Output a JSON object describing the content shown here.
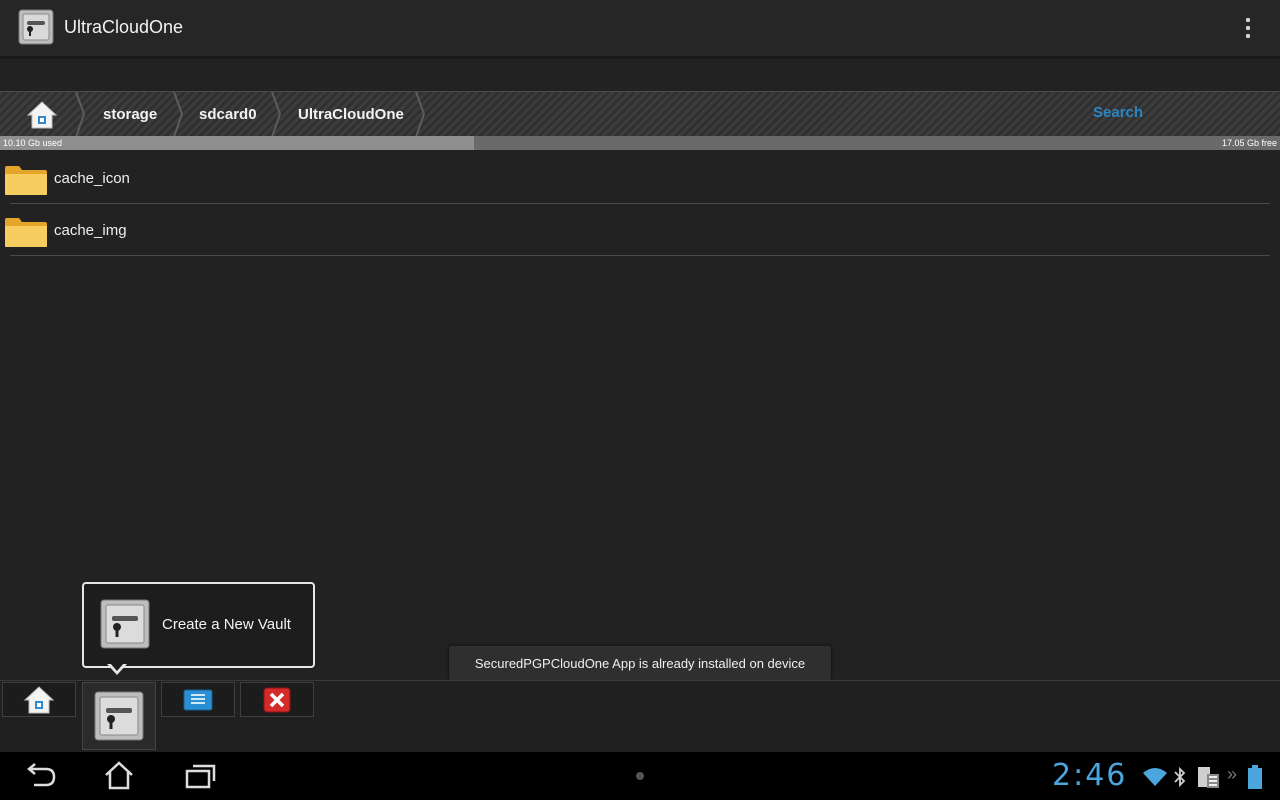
{
  "app": {
    "title": "UltraCloudOne",
    "icon": "vault-key-icon"
  },
  "breadcrumb": {
    "home_icon": "home-icon",
    "items": [
      "storage",
      "sdcard0",
      "UltraCloudOne"
    ],
    "search_label": "Search"
  },
  "storage": {
    "used_label": "10.10 Gb used",
    "free_label": "17.05 Gb free",
    "used_fraction": 0.37
  },
  "files": [
    {
      "name": "cache_icon",
      "icon": "folder-icon"
    },
    {
      "name": "cache_img",
      "icon": "folder-icon"
    }
  ],
  "popup": {
    "label": "Create a New Vault",
    "icon": "vault-key-icon"
  },
  "toast": {
    "message": "SecuredPGPCloudOne App is already installed on device"
  },
  "toolbar": {
    "buttons": [
      "home-icon",
      "vault-key-icon",
      "file-icon",
      "close-icon"
    ]
  },
  "status": {
    "time": "2:46"
  },
  "colors": {
    "accent": "#2b86c4",
    "clock": "#4aa6dd",
    "folder": "#f3c24f"
  }
}
